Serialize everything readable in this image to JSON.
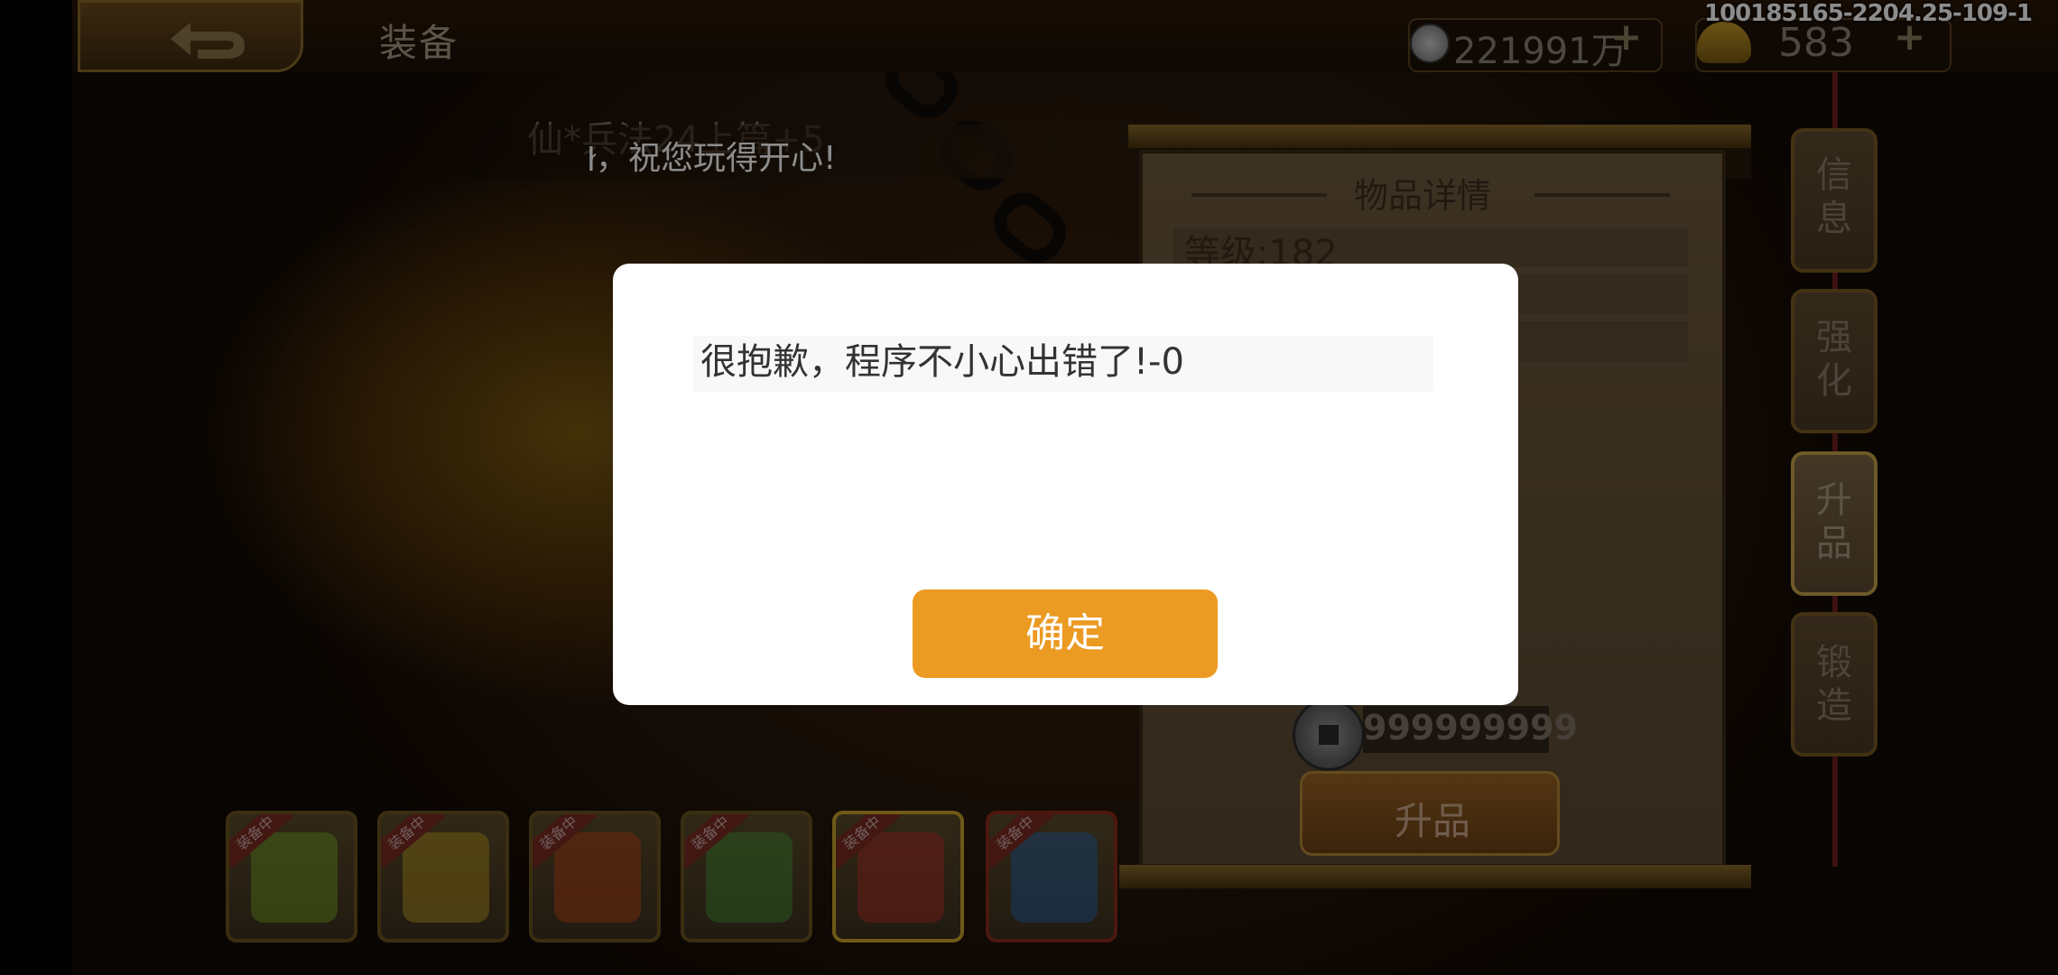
{
  "topbar": {
    "title": "装备",
    "silver": "221991万",
    "gold": "583",
    "build_id": "100185165-2204.25-109-1"
  },
  "item": {
    "name": "仙*兵法24上篇+5"
  },
  "marquee": {
    "text": "，祝您玩得开心!",
    "cut_prefix": "h"
  },
  "detail": {
    "title": "物品详情",
    "level": "等级:182",
    "cost": "999999999",
    "upgrade_label": "升品"
  },
  "side_tabs": [
    {
      "label": "信息"
    },
    {
      "label": "强化"
    },
    {
      "label": "升品"
    },
    {
      "label": "锻造"
    }
  ],
  "slots": [
    {
      "ribbon": "装备中",
      "icon": "sword-icon",
      "color": "#7fb02a"
    },
    {
      "ribbon": "装备中",
      "icon": "armor-icon",
      "color": "#c9a524"
    },
    {
      "ribbon": "装备中",
      "icon": "helmet-icon",
      "color": "#c84a1a"
    },
    {
      "ribbon": "装备中",
      "icon": "jade-beast-icon",
      "color": "#4a9a3a"
    },
    {
      "ribbon": "装备中",
      "icon": "book-icon",
      "color": "#b8322a"
    },
    {
      "ribbon": "装备中",
      "icon": "mount-icon",
      "color": "#2a6ab0"
    }
  ],
  "dialog": {
    "message": "很抱歉，程序不小心出错了!-0",
    "ok_label": "确定"
  }
}
